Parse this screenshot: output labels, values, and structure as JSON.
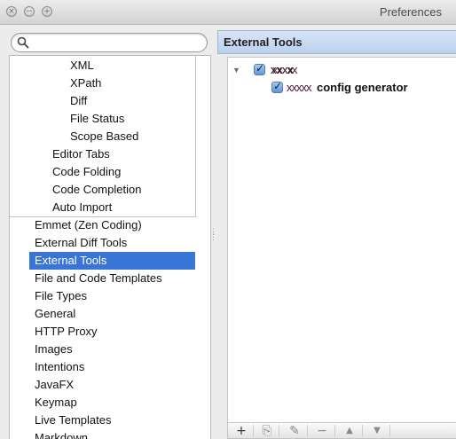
{
  "window": {
    "title": "Preferences",
    "buttons": {
      "close": "×",
      "minimize": "−",
      "zoom": "+"
    }
  },
  "search": {
    "value": "",
    "placeholder": "",
    "icon": "search-icon"
  },
  "settings_tree": {
    "nested_items": [
      {
        "label": "XML"
      },
      {
        "label": "XPath"
      },
      {
        "label": "Diff"
      },
      {
        "label": "File Status"
      },
      {
        "label": "Scope Based"
      },
      {
        "label": "Editor Tabs"
      },
      {
        "label": "Code Folding"
      },
      {
        "label": "Code Completion"
      },
      {
        "label": "Auto Import"
      }
    ],
    "items": [
      {
        "label": "Emmet (Zen Coding)"
      },
      {
        "label": "External Diff Tools"
      },
      {
        "label": "External Tools",
        "selected": true
      },
      {
        "label": "File and Code Templates"
      },
      {
        "label": "File Types"
      },
      {
        "label": "General"
      },
      {
        "label": "HTTP Proxy"
      },
      {
        "label": "Images"
      },
      {
        "label": "Intentions"
      },
      {
        "label": "JavaFX"
      },
      {
        "label": "Keymap"
      },
      {
        "label": "Live Templates"
      },
      {
        "label": "Markdown"
      }
    ]
  },
  "panel": {
    "title": "External Tools",
    "group": {
      "label": "xxxx",
      "checked": true,
      "expanded": true
    },
    "tool": {
      "label_suffix": "config generator",
      "checked": true
    }
  },
  "toolbar": {
    "buttons": [
      {
        "name": "add",
        "glyph": "+",
        "enabled": true
      },
      {
        "name": "copy",
        "glyph": "⎘",
        "enabled": false
      },
      {
        "name": "edit",
        "glyph": "✎",
        "enabled": false
      },
      {
        "name": "remove",
        "glyph": "−",
        "enabled": false
      },
      {
        "name": "move-up",
        "glyph": "▲",
        "enabled": false
      },
      {
        "name": "move-down",
        "glyph": "▼",
        "enabled": false
      }
    ]
  },
  "colors": {
    "selection": "#3875d7",
    "panel_header": "#c9dbf2",
    "window_bg": "#ececec"
  }
}
